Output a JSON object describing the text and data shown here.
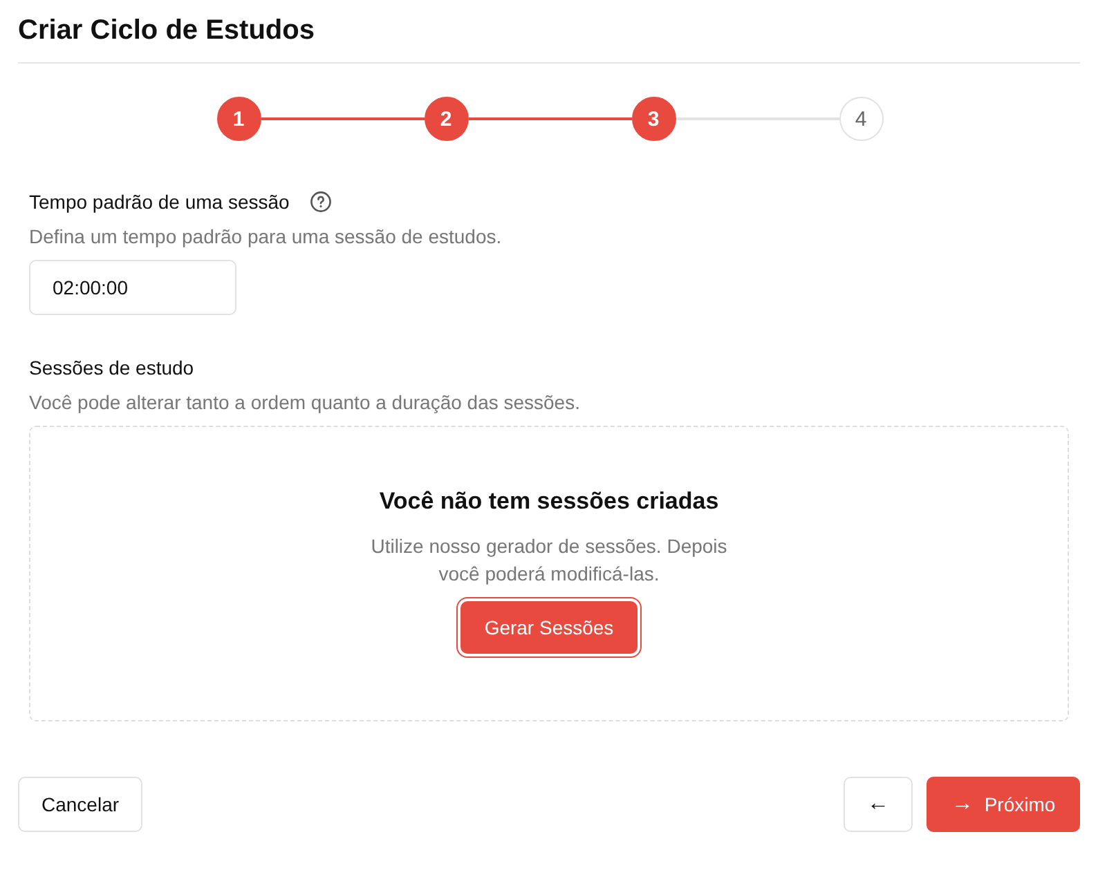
{
  "title": "Criar Ciclo de Estudos",
  "steps": [
    {
      "label": "1",
      "completed": true
    },
    {
      "label": "2",
      "completed": true
    },
    {
      "label": "3",
      "completed": true
    },
    {
      "label": "4",
      "completed": false
    }
  ],
  "default_time": {
    "label": "Tempo padrão de uma sessão",
    "help": "Defina um tempo padrão para uma sessão de estudos.",
    "value": "02:00:00"
  },
  "sessions": {
    "label": "Sessões de estudo",
    "help": "Você pode alterar tanto a ordem quanto a duração das sessões.",
    "empty_title": "Você não tem sessões criadas",
    "empty_text": "Utilize nosso gerador de sessões. Depois você poderá modificá-las.",
    "button": {
      "label": "Gerar Sessões",
      "focused": true
    }
  },
  "footer": {
    "cancel": "Cancelar",
    "back": "←",
    "next_icon": "→",
    "next": "Próximo"
  }
}
